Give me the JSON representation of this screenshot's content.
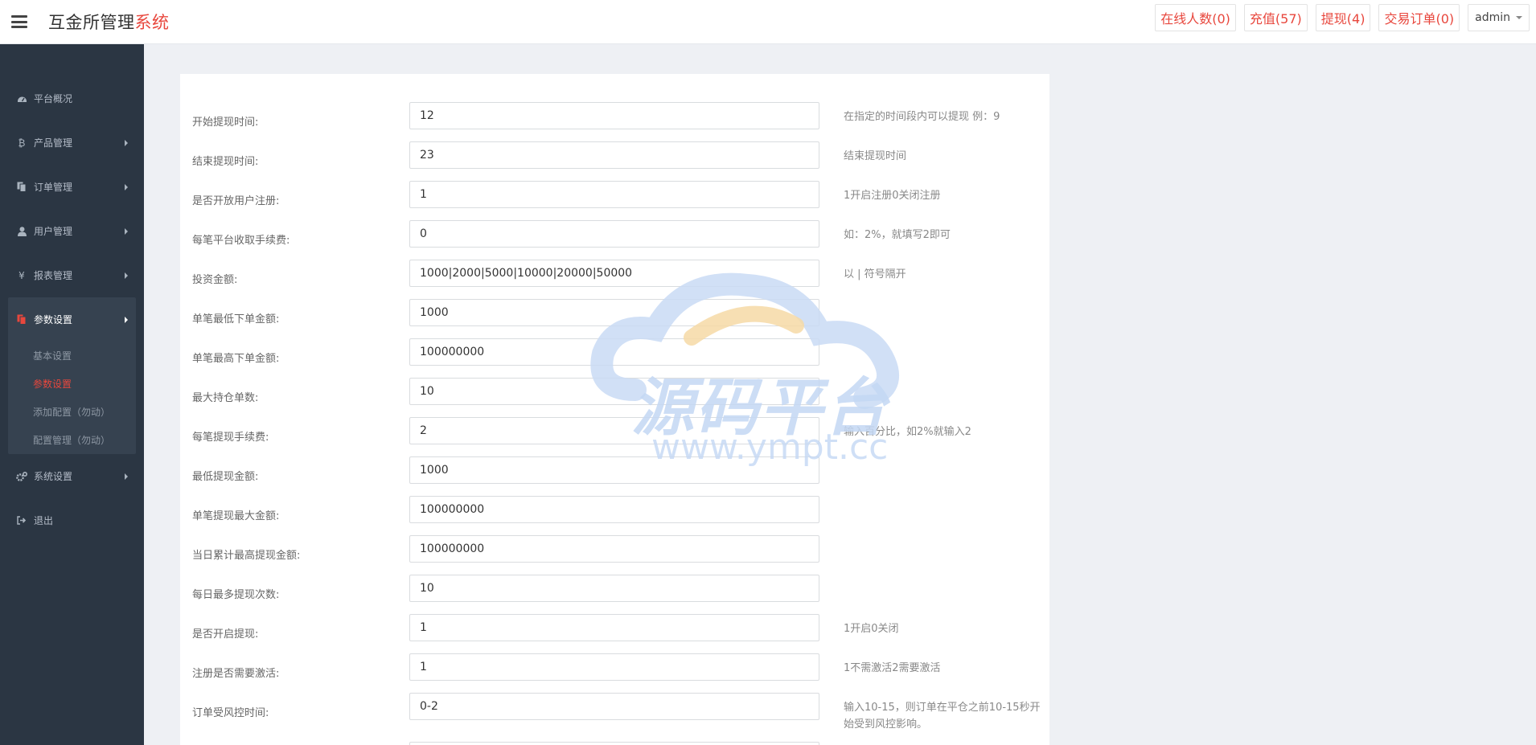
{
  "app": {
    "title_main": "互金所管理",
    "title_accent": "系统"
  },
  "header": {
    "actions": [
      {
        "label": "在线人数(0)"
      },
      {
        "label": "充值(57)"
      },
      {
        "label": "提现(4)"
      },
      {
        "label": "交易订单(0)"
      }
    ],
    "user": "admin"
  },
  "sidebar": {
    "items": [
      {
        "label": "平台概况",
        "icon": "dashboard-icon"
      },
      {
        "label": "产品管理",
        "icon": "bitcoin-icon"
      },
      {
        "label": "订单管理",
        "icon": "copy-icon"
      },
      {
        "label": "用户管理",
        "icon": "user-icon"
      },
      {
        "label": "报表管理",
        "icon": "yen-icon"
      },
      {
        "label": "参数设置",
        "icon": "copy-icon"
      },
      {
        "label": "系统设置",
        "icon": "cogs-icon"
      },
      {
        "label": "退出",
        "icon": "sign-out-icon"
      }
    ],
    "sub_items": [
      {
        "label": "基本设置"
      },
      {
        "label": "参数设置"
      },
      {
        "label": "添加配置（勿动）"
      },
      {
        "label": "配置管理（勿动）"
      }
    ]
  },
  "form": {
    "rows": [
      {
        "label": "开始提现时间:",
        "value": "12",
        "help": "在指定的时间段内可以提现 例：9"
      },
      {
        "label": "结束提现时间:",
        "value": "23",
        "help": "结束提现时间"
      },
      {
        "label": "是否开放用户注册:",
        "value": "1",
        "help": "1开启注册0关闭注册"
      },
      {
        "label": "每笔平台收取手续费:",
        "value": "0",
        "help": "如：2%，就填写2即可"
      },
      {
        "label": "投资金额:",
        "value": "1000|2000|5000|10000|20000|50000",
        "help": "以 | 符号隔开"
      },
      {
        "label": "单笔最低下单金额:",
        "value": "1000",
        "help": ""
      },
      {
        "label": "单笔最高下单金额:",
        "value": "100000000",
        "help": ""
      },
      {
        "label": "最大持仓单数:",
        "value": "10",
        "help": ""
      },
      {
        "label": "每笔提现手续费:",
        "value": "2",
        "help": "输入百分比，如2%就输入2"
      },
      {
        "label": "最低提现金额:",
        "value": "1000",
        "help": ""
      },
      {
        "label": "单笔提现最大金额:",
        "value": "100000000",
        "help": ""
      },
      {
        "label": "当日累计最高提现金额:",
        "value": "100000000",
        "help": ""
      },
      {
        "label": "每日最多提现次数:",
        "value": "10",
        "help": ""
      },
      {
        "label": "是否开启提现:",
        "value": "1",
        "help": "1开启0关闭"
      },
      {
        "label": "注册是否需要激活:",
        "value": "1",
        "help": "1不需激活2需要激活"
      },
      {
        "label": "订单受风控时间:",
        "value": "0-2",
        "help": "输入10-15，则订单在平仓之前10-15秒开始受到风控影响。"
      },
      {
        "label": "",
        "value": "",
        "help": ""
      }
    ]
  },
  "watermark": {
    "text": "源码平台",
    "url": "www.ympt.cc"
  },
  "colors": {
    "accent": "#e8473d",
    "sidebar_bg": "#2b3643",
    "content_bg": "#eef0f4"
  }
}
